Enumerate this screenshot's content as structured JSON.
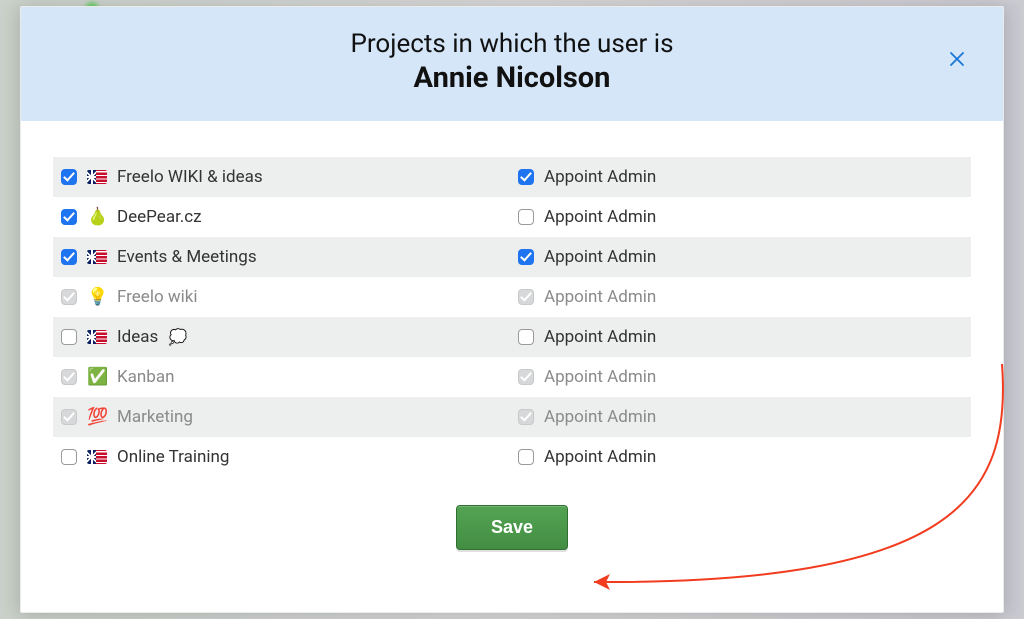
{
  "header": {
    "title_line1": "Projects in which the user is",
    "title_line2": "Annie Nicolson"
  },
  "admin_label": "Appoint Admin",
  "projects": [
    {
      "icon": "flag-uk",
      "name": "Freelo WIKI & ideas",
      "member": true,
      "admin": true,
      "disabled": false
    },
    {
      "icon": "pear",
      "name": "DeePear.cz",
      "member": true,
      "admin": false,
      "disabled": false
    },
    {
      "icon": "flag-uk",
      "name": "Events & Meetings",
      "member": true,
      "admin": true,
      "disabled": false
    },
    {
      "icon": "bulb",
      "name": "Freelo wiki",
      "member": true,
      "admin": true,
      "disabled": true
    },
    {
      "icon": "flag-uk",
      "name": "Ideas",
      "name_suffix_icon": "cloud",
      "member": false,
      "admin": false,
      "disabled": false
    },
    {
      "icon": "checkbox",
      "name": "Kanban",
      "member": true,
      "admin": true,
      "disabled": true
    },
    {
      "icon": "100",
      "name": "Marketing",
      "member": true,
      "admin": true,
      "disabled": true
    },
    {
      "icon": "flag-uk",
      "name": "Online Training",
      "member": false,
      "admin": false,
      "disabled": false
    }
  ],
  "buttons": {
    "save": "Save"
  },
  "colors": {
    "header_bg": "#d4e6f8",
    "accent_blue": "#1f75f0",
    "save_green": "#4c9a4c",
    "annotation_red": "#f23c1f"
  }
}
